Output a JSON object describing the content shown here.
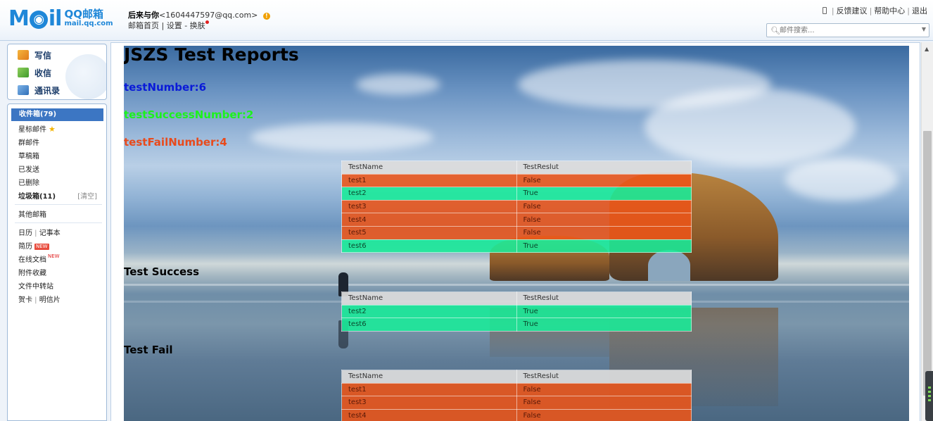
{
  "header": {
    "logo_mail": "M",
    "logo_mail_rest": "il",
    "logo_qq": "QQ邮箱",
    "logo_domain": "mail.qq.com",
    "user_name": "后来与你",
    "user_email": "<1604447597@qq.com>",
    "sub_links": [
      "邮箱首页",
      "设置",
      "换肤"
    ],
    "right_links": [
      "反馈建议",
      "帮助中心",
      "退出"
    ],
    "search_placeholder": "邮件搜索..."
  },
  "sidebar": {
    "actions": [
      "写信",
      "收信",
      "通讯录"
    ],
    "folders": {
      "inbox": "收件箱(79)",
      "starred": "星标邮件",
      "group": "群邮件",
      "drafts": "草稿箱",
      "sent": "已发送",
      "deleted": "已删除",
      "junk": "垃圾箱(11)",
      "junk_clear": "[清空]",
      "other": "其他邮箱"
    },
    "tools": {
      "calendar": "日历",
      "notes": "记事本",
      "resume": "简历",
      "resume_badge": "NEW",
      "online_docs": "在线文档",
      "online_docs_badge": "NEW",
      "attachments": "附件收藏",
      "file_transfer": "文件中转站",
      "cards": "贺卡",
      "postcards": "明信片"
    }
  },
  "report": {
    "title": "JSZS Test Reports",
    "test_number": "testNumber:6",
    "test_success_number": "testSuccessNumber:2",
    "test_fail_number": "testFailNumber:4",
    "columns": [
      "TestName",
      "TestReslut"
    ],
    "all_results": [
      {
        "name": "test1",
        "result": "False"
      },
      {
        "name": "test2",
        "result": "True"
      },
      {
        "name": "test3",
        "result": "False"
      },
      {
        "name": "test4",
        "result": "False"
      },
      {
        "name": "test5",
        "result": "False"
      },
      {
        "name": "test6",
        "result": "True"
      }
    ],
    "success_heading": "Test Success",
    "success_results": [
      {
        "name": "test2",
        "result": "True"
      },
      {
        "name": "test6",
        "result": "True"
      }
    ],
    "fail_heading": "Test Fail",
    "fail_results": [
      {
        "name": "test1",
        "result": "False"
      },
      {
        "name": "test3",
        "result": "False"
      },
      {
        "name": "test4",
        "result": "False"
      }
    ]
  },
  "colors": {
    "brand": "#1f87d8",
    "inbox_active": "#3c76c3",
    "fail_row": "#ec5418",
    "success_row": "#18ec98",
    "number_text": "#0a1ad8",
    "success_text": "#1cf21c",
    "fail_text": "#e84a1c"
  }
}
